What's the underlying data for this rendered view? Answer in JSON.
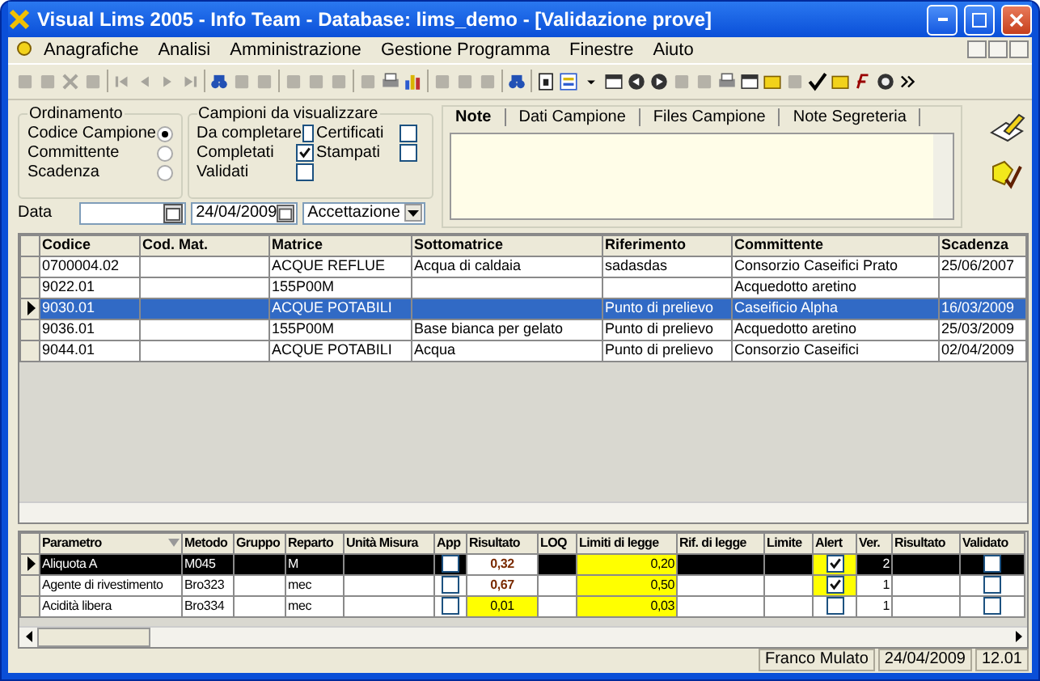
{
  "window": {
    "title": "Visual Lims 2005 - Info Team - Database: lims_demo - [Validazione prove]"
  },
  "menu": [
    "Anagrafiche",
    "Analisi",
    "Amministrazione",
    "Gestione Programma",
    "Finestre",
    "Aiuto"
  ],
  "sort": {
    "title": "Ordinamento",
    "options": [
      {
        "label": "Codice Campione",
        "selected": true
      },
      {
        "label": "Committente",
        "selected": false
      },
      {
        "label": "Scadenza",
        "selected": false
      }
    ]
  },
  "filter": {
    "title": "Campioni da visualizzare",
    "options": [
      {
        "label": "Da completare",
        "checked": false
      },
      {
        "label": "Certificati",
        "checked": false
      },
      {
        "label": "Completati",
        "checked": true
      },
      {
        "label": "Stampati",
        "checked": false
      },
      {
        "label": "Validati",
        "checked": false
      }
    ]
  },
  "tabs": [
    {
      "label": "Note",
      "selected": true
    },
    {
      "label": "Dati Campione",
      "selected": false
    },
    {
      "label": "Files Campione",
      "selected": false
    },
    {
      "label": "Note Segreteria",
      "selected": false
    }
  ],
  "date_filter": {
    "label": "Data",
    "to": "24/04/2009",
    "stage": "Accettazione"
  },
  "samples": {
    "columns": [
      "Codice",
      "Cod. Mat.",
      "Matrice",
      "Sottomatrice",
      "Riferimento",
      "Committente",
      "Scadenza"
    ],
    "rows": [
      {
        "selected": false,
        "cells": [
          "0700004.02",
          null,
          "ACQUE REFLUE",
          "Acqua di caldaia",
          "sadasdas",
          "Consorzio Caseifici Prato",
          "25/06/2007"
        ]
      },
      {
        "selected": false,
        "cells": [
          "9022.01",
          null,
          "155P00M",
          null,
          null,
          "Acquedotto aretino",
          null
        ]
      },
      {
        "selected": true,
        "cells": [
          "9030.01",
          null,
          "ACQUE POTABILI",
          null,
          "Punto di prelievo",
          "Caseificio Alpha",
          "16/03/2009"
        ]
      },
      {
        "selected": false,
        "cells": [
          "9036.01",
          null,
          "155P00M",
          "Base bianca per gelato",
          "Punto di prelievo",
          "Acquedotto aretino",
          "25/03/2009"
        ]
      },
      {
        "selected": false,
        "cells": [
          "9044.01",
          null,
          "ACQUE POTABILI",
          "Acqua",
          "Punto di prelievo",
          "Consorzio Caseifici",
          "02/04/2009"
        ]
      }
    ]
  },
  "results": {
    "columns": [
      "Parametro",
      "Metodo",
      "Gruppo",
      "Reparto",
      "Unità Misura",
      "App",
      "Risultato",
      "LOQ",
      "Limiti di legge",
      "Rif. di legge",
      "Limite",
      "Alert",
      "Ver.",
      "Risultato",
      "Validato"
    ],
    "rows": [
      {
        "selected": true,
        "out_of_limit": true,
        "cells": [
          "Aliquota A",
          "M045",
          null,
          "M",
          null,
          false,
          "0,32",
          null,
          "0,20",
          null,
          null,
          true,
          "2",
          null,
          false
        ]
      },
      {
        "selected": false,
        "out_of_limit": true,
        "cells": [
          "Agente di rivestimento",
          "Bro323",
          null,
          "mec",
          null,
          false,
          "0,67",
          null,
          "0,50",
          null,
          null,
          true,
          "1",
          null,
          false
        ]
      },
      {
        "selected": false,
        "out_of_limit": false,
        "cells": [
          "Acidità libera",
          "Bro334",
          null,
          "mec",
          null,
          false,
          "0,01",
          null,
          "0,03",
          null,
          null,
          false,
          "1",
          null,
          false
        ]
      }
    ]
  },
  "status_bar": [
    "Franco Mulato",
    "24/04/2009",
    "12.01"
  ]
}
